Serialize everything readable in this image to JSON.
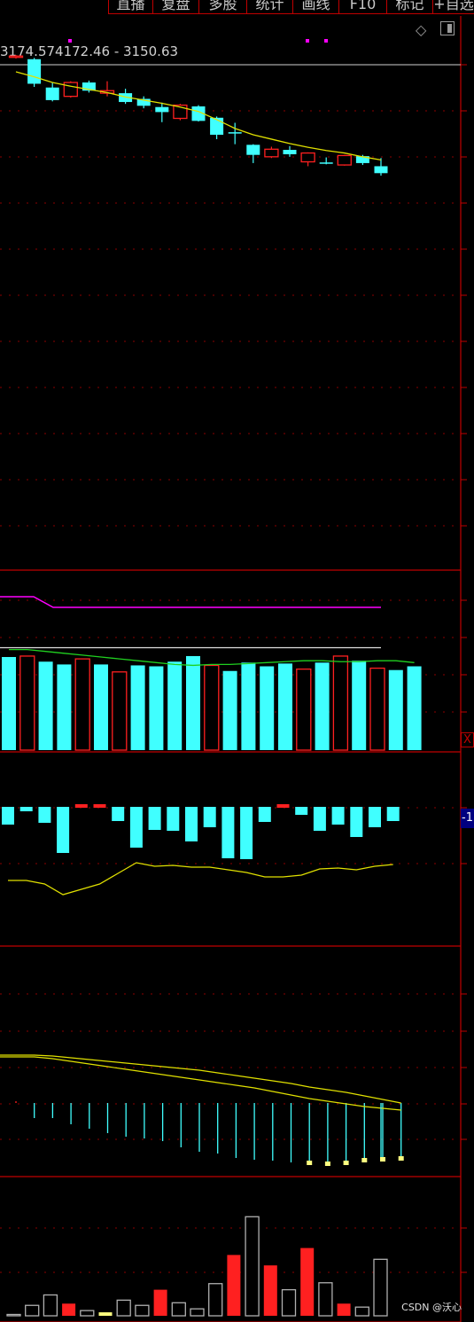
{
  "toolbar": {
    "buttons": [
      "直播",
      "复盘",
      "多股",
      "统计",
      "画线",
      "F10",
      "标记",
      "+自选"
    ]
  },
  "price_panel": {
    "label_prefix": "3174.57",
    "label_range": "4172.46 - 3150.63",
    "corner_icons": [
      "diamond-icon",
      "panel-toggle-icon"
    ]
  },
  "side_tags": {
    "x_label": "X",
    "neg_label": "-1"
  },
  "watermark": "CSDN @沃心",
  "colors": {
    "up": "#ff2020",
    "down": "#40ffff",
    "ma": "#e0e000",
    "purple": "#ff00ff",
    "green": "#20d020",
    "grid": "#8b0000",
    "border": "#c00000",
    "gray_bar": "#b0b0b0",
    "cream": "#ffff80"
  },
  "chart_data": [
    {
      "type": "candlestick",
      "panel": "price",
      "title": "",
      "ylim": [
        3150.63,
        3174.57
      ],
      "ohlc": [
        {
          "o": 3174.4,
          "h": 3174.57,
          "c": 3174.2,
          "l": 3174.0,
          "dir": "up"
        },
        {
          "o": 3173.9,
          "h": 3174.1,
          "c": 3170.0,
          "l": 3169.5,
          "dir": "down"
        },
        {
          "o": 3169.4,
          "h": 3170.2,
          "c": 3167.4,
          "l": 3167.2,
          "dir": "down"
        },
        {
          "o": 3168.0,
          "h": 3170.4,
          "c": 3170.2,
          "l": 3167.8,
          "dir": "up"
        },
        {
          "o": 3170.2,
          "h": 3170.5,
          "c": 3168.9,
          "l": 3168.6,
          "dir": "down"
        },
        {
          "o": 3168.5,
          "h": 3170.4,
          "c": 3168.9,
          "l": 3168.0,
          "dir": "up"
        },
        {
          "o": 3168.5,
          "h": 3169.2,
          "c": 3167.1,
          "l": 3166.8,
          "dir": "down"
        },
        {
          "o": 3167.6,
          "h": 3168.0,
          "c": 3166.5,
          "l": 3166.1,
          "dir": "down"
        },
        {
          "o": 3166.3,
          "h": 3167.0,
          "c": 3165.5,
          "l": 3163.9,
          "dir": "down"
        },
        {
          "o": 3164.5,
          "h": 3166.8,
          "c": 3166.6,
          "l": 3164.2,
          "dir": "up"
        },
        {
          "o": 3166.4,
          "h": 3166.6,
          "c": 3164.1,
          "l": 3164.0,
          "dir": "down"
        },
        {
          "o": 3164.6,
          "h": 3164.8,
          "c": 3161.9,
          "l": 3161.2,
          "dir": "down"
        },
        {
          "o": 3162.3,
          "h": 3163.8,
          "c": 3162.2,
          "l": 3160.4,
          "dir": "down"
        },
        {
          "o": 3160.3,
          "h": 3160.4,
          "c": 3158.7,
          "l": 3157.4,
          "dir": "down"
        },
        {
          "o": 3158.4,
          "h": 3160.0,
          "c": 3159.6,
          "l": 3158.2,
          "dir": "up"
        },
        {
          "o": 3159.5,
          "h": 3160.1,
          "c": 3158.8,
          "l": 3158.4,
          "dir": "down"
        },
        {
          "o": 3157.6,
          "h": 3159.1,
          "c": 3159.0,
          "l": 3156.9,
          "dir": "up"
        },
        {
          "o": 3157.5,
          "h": 3158.3,
          "c": 3157.5,
          "l": 3157.2,
          "dir": "down"
        },
        {
          "o": 3157.1,
          "h": 3158.7,
          "c": 3158.6,
          "l": 3157.0,
          "dir": "up"
        },
        {
          "o": 3158.5,
          "h": 3158.7,
          "c": 3157.4,
          "l": 3157.1,
          "dir": "down"
        },
        {
          "o": 3156.9,
          "h": 3158.2,
          "c": 3155.8,
          "l": 3155.4,
          "dir": "down"
        }
      ],
      "ma": [
        3171.9,
        3171.1,
        3170.2,
        3169.6,
        3169.1,
        3168.6,
        3167.9,
        3167.4,
        3166.9,
        3166.3,
        3165.6,
        3164.3,
        3162.9,
        3161.9,
        3161.2,
        3160.5,
        3159.9,
        3159.4,
        3159.0,
        3158.4,
        3157.9
      ]
    },
    {
      "type": "bar",
      "panel": "volume-indicator",
      "ylim": [
        0,
        110
      ],
      "values": [
        100,
        101,
        95,
        92,
        98,
        92,
        84,
        91,
        90,
        95,
        101,
        91,
        85,
        94,
        90,
        93,
        87,
        94,
        101,
        96,
        88,
        86,
        90
      ],
      "directions": [
        "down",
        "up",
        "down",
        "down",
        "up",
        "down",
        "up",
        "down",
        "down",
        "down",
        "down",
        "up",
        "down",
        "down",
        "down",
        "down",
        "up",
        "down",
        "up",
        "down",
        "up",
        "down",
        "down"
      ],
      "green_line": [
        108,
        108,
        106,
        104,
        102,
        100,
        98,
        96,
        94,
        92,
        91,
        92,
        92,
        93,
        94,
        95,
        96,
        96,
        95,
        95,
        96,
        96,
        94
      ],
      "white_line": 110,
      "purple_line": [
        165,
        165,
        165,
        156,
        156,
        156,
        156,
        156,
        156,
        156,
        156,
        156,
        156,
        156,
        156,
        156,
        156,
        156,
        156,
        156,
        156,
        156,
        156
      ]
    },
    {
      "type": "bar",
      "panel": "oscillator",
      "ylim": [
        -60,
        0
      ],
      "values": [
        -20,
        -5,
        -18,
        -52,
        -2,
        -2,
        -16,
        -46,
        -26,
        -27,
        -39,
        -23,
        -58,
        -59,
        -17,
        -1,
        -9,
        -27,
        -20,
        -34,
        -23,
        -16
      ],
      "directions": [
        "down",
        "down",
        "down",
        "down",
        "up",
        "up",
        "down",
        "down",
        "down",
        "down",
        "down",
        "down",
        "down",
        "down",
        "down",
        "up",
        "down",
        "down",
        "down",
        "down",
        "down",
        "down"
      ],
      "line": [
        22,
        22,
        18,
        6,
        12,
        18,
        30,
        42,
        38,
        39,
        37,
        37,
        34,
        31,
        26,
        26,
        28,
        35,
        36,
        34,
        38,
        40
      ]
    },
    {
      "type": "bar",
      "panel": "macd",
      "ylim": [
        -62,
        5
      ],
      "values": [
        2,
        -17,
        -17,
        -24,
        -29,
        -34,
        -38,
        -40,
        -43,
        -50,
        -55,
        -57,
        -62,
        -64,
        -65,
        -67,
        -67,
        -68,
        -67,
        -64,
        -63,
        -62
      ],
      "line_a": [
        56,
        56,
        54,
        51,
        48,
        45,
        42,
        39,
        36,
        33,
        30,
        27,
        24,
        21,
        17,
        13,
        9,
        6,
        3,
        0,
        -2,
        -4
      ],
      "line_b": [
        58,
        58,
        57,
        55,
        53,
        51,
        49,
        47,
        45,
        43,
        41,
        38,
        35,
        32,
        29,
        26,
        22,
        19,
        16,
        12,
        8,
        4
      ]
    },
    {
      "type": "bar",
      "panel": "volume",
      "ylim": [
        0,
        115
      ],
      "values": [
        1,
        12,
        24,
        14,
        6,
        4,
        18,
        12,
        30,
        15,
        8,
        37,
        70,
        114,
        58,
        30,
        78,
        38,
        14,
        10,
        65
      ],
      "directions": [
        "down",
        "down",
        "down",
        "up",
        "down",
        "cream",
        "down",
        "down",
        "up",
        "down",
        "down",
        "down",
        "up",
        "down",
        "up",
        "down",
        "up",
        "down",
        "up",
        "down",
        "down"
      ]
    }
  ]
}
